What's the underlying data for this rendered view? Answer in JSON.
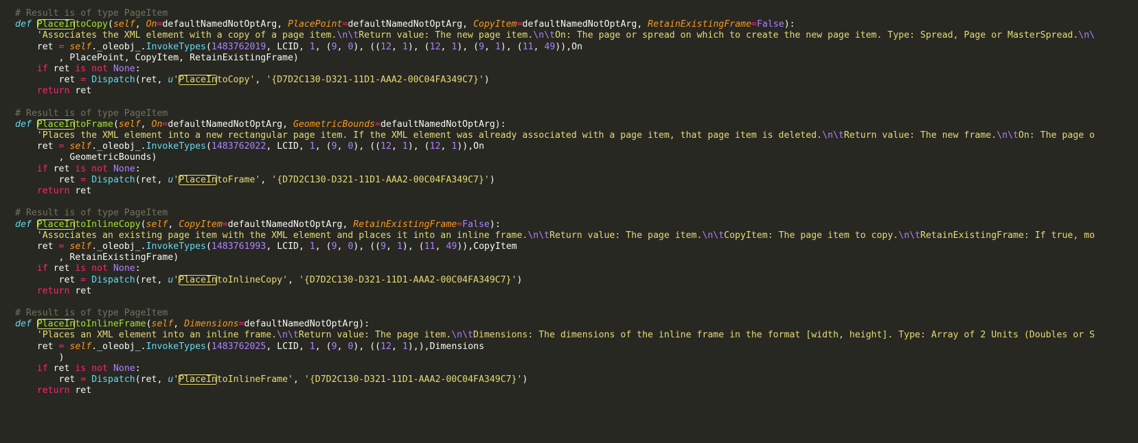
{
  "editor": {
    "lines": [
      [
        [
          "c-cmt",
          "# Result is of type PageItem"
        ]
      ],
      [
        [
          "c-def",
          "def"
        ],
        [
          "c-pl",
          " "
        ],
        [
          "c-hl hl-fn",
          "PlaceIn"
        ],
        [
          "c-fn",
          "toCopy"
        ],
        [
          "c-pl",
          "("
        ],
        [
          "c-self",
          "self"
        ],
        [
          "c-pl",
          ", "
        ],
        [
          "c-prm",
          "On"
        ],
        [
          "c-op",
          "="
        ],
        [
          "c-pl",
          "defaultNamedNotOptArg, "
        ],
        [
          "c-prm",
          "PlacePoint"
        ],
        [
          "c-op",
          "="
        ],
        [
          "c-pl",
          "defaultNamedNotOptArg, "
        ],
        [
          "c-prm",
          "CopyItem"
        ],
        [
          "c-op",
          "="
        ],
        [
          "c-pl",
          "defaultNamedNotOptArg, "
        ],
        [
          "c-prm",
          "RetainExistingFrame"
        ],
        [
          "c-op",
          "="
        ],
        [
          "c-const",
          "False"
        ],
        [
          "c-pl",
          "):"
        ]
      ],
      [
        [
          "c-pl",
          "    "
        ],
        [
          "c-str",
          "'Associates the XML element with a copy of a page item."
        ],
        [
          "c-esc",
          "\\n\\t"
        ],
        [
          "c-str",
          "Return value: The new page item."
        ],
        [
          "c-esc",
          "\\n\\t"
        ],
        [
          "c-str",
          "On: The page or spread on which to create the new page item. Type: Spread, Page or MasterSpread."
        ],
        [
          "c-esc",
          "\\n\\"
        ]
      ],
      [
        [
          "c-pl",
          "    ret "
        ],
        [
          "c-op",
          "="
        ],
        [
          "c-pl",
          " "
        ],
        [
          "c-self",
          "self"
        ],
        [
          "c-pl",
          "._oleobj_."
        ],
        [
          "c-call",
          "InvokeTypes"
        ],
        [
          "c-pl",
          "("
        ],
        [
          "c-num",
          "1483762019"
        ],
        [
          "c-pl",
          ", LCID, "
        ],
        [
          "c-num",
          "1"
        ],
        [
          "c-pl",
          ", ("
        ],
        [
          "c-num",
          "9"
        ],
        [
          "c-pl",
          ", "
        ],
        [
          "c-num",
          "0"
        ],
        [
          "c-pl",
          "), (("
        ],
        [
          "c-num",
          "12"
        ],
        [
          "c-pl",
          ", "
        ],
        [
          "c-num",
          "1"
        ],
        [
          "c-pl",
          "), ("
        ],
        [
          "c-num",
          "12"
        ],
        [
          "c-pl",
          ", "
        ],
        [
          "c-num",
          "1"
        ],
        [
          "c-pl",
          "), ("
        ],
        [
          "c-num",
          "9"
        ],
        [
          "c-pl",
          ", "
        ],
        [
          "c-num",
          "1"
        ],
        [
          "c-pl",
          "), ("
        ],
        [
          "c-num",
          "11"
        ],
        [
          "c-pl",
          ", "
        ],
        [
          "c-num",
          "49"
        ],
        [
          "c-pl",
          ")),On"
        ]
      ],
      [
        [
          "c-pl",
          "        , PlacePoint, CopyItem, RetainExistingFrame)"
        ]
      ],
      [
        [
          "c-pl",
          "    "
        ],
        [
          "c-kw",
          "if"
        ],
        [
          "c-pl",
          " ret "
        ],
        [
          "c-kw",
          "is not"
        ],
        [
          "c-pl",
          " "
        ],
        [
          "c-const",
          "None"
        ],
        [
          "c-pl",
          ":"
        ]
      ],
      [
        [
          "c-pl",
          "        ret "
        ],
        [
          "c-op",
          "="
        ],
        [
          "c-pl",
          " "
        ],
        [
          "c-call",
          "Dispatch"
        ],
        [
          "c-pl",
          "(ret, "
        ],
        [
          "c-def",
          "u"
        ],
        [
          "c-str",
          "'"
        ],
        [
          "c-hl hl-str",
          "PlaceIn"
        ],
        [
          "c-str",
          "toCopy'"
        ],
        [
          "c-pl",
          ", "
        ],
        [
          "c-str",
          "'{D7D2C130-D321-11D1-AAA2-00C04FA349C7}'"
        ],
        [
          "c-pl",
          ")"
        ]
      ],
      [
        [
          "c-pl",
          "    "
        ],
        [
          "c-kw",
          "return"
        ],
        [
          "c-pl",
          " ret"
        ]
      ],
      [],
      [
        [
          "c-cmt",
          "# Result is of type PageItem"
        ]
      ],
      [
        [
          "c-def",
          "def"
        ],
        [
          "c-pl",
          " "
        ],
        [
          "c-hl hl-fn",
          "PlaceIn"
        ],
        [
          "c-fn",
          "toFrame"
        ],
        [
          "c-pl",
          "("
        ],
        [
          "c-self",
          "self"
        ],
        [
          "c-pl",
          ", "
        ],
        [
          "c-prm",
          "On"
        ],
        [
          "c-op",
          "="
        ],
        [
          "c-pl",
          "defaultNamedNotOptArg, "
        ],
        [
          "c-prm",
          "GeometricBounds"
        ],
        [
          "c-op",
          "="
        ],
        [
          "c-pl",
          "defaultNamedNotOptArg):"
        ]
      ],
      [
        [
          "c-pl",
          "    "
        ],
        [
          "c-str",
          "'Places the XML element into a new rectangular page item. If the XML element was already associated with a page item, that page item is deleted."
        ],
        [
          "c-esc",
          "\\n\\t"
        ],
        [
          "c-str",
          "Return value: The new frame."
        ],
        [
          "c-esc",
          "\\n\\t"
        ],
        [
          "c-str",
          "On: The page o"
        ]
      ],
      [
        [
          "c-pl",
          "    ret "
        ],
        [
          "c-op",
          "="
        ],
        [
          "c-pl",
          " "
        ],
        [
          "c-self",
          "self"
        ],
        [
          "c-pl",
          "._oleobj_."
        ],
        [
          "c-call",
          "InvokeTypes"
        ],
        [
          "c-pl",
          "("
        ],
        [
          "c-num",
          "1483762022"
        ],
        [
          "c-pl",
          ", LCID, "
        ],
        [
          "c-num",
          "1"
        ],
        [
          "c-pl",
          ", ("
        ],
        [
          "c-num",
          "9"
        ],
        [
          "c-pl",
          ", "
        ],
        [
          "c-num",
          "0"
        ],
        [
          "c-pl",
          "), (("
        ],
        [
          "c-num",
          "12"
        ],
        [
          "c-pl",
          ", "
        ],
        [
          "c-num",
          "1"
        ],
        [
          "c-pl",
          "), ("
        ],
        [
          "c-num",
          "12"
        ],
        [
          "c-pl",
          ", "
        ],
        [
          "c-num",
          "1"
        ],
        [
          "c-pl",
          ")),On"
        ]
      ],
      [
        [
          "c-pl",
          "        , GeometricBounds)"
        ]
      ],
      [
        [
          "c-pl",
          "    "
        ],
        [
          "c-kw",
          "if"
        ],
        [
          "c-pl",
          " ret "
        ],
        [
          "c-kw",
          "is not"
        ],
        [
          "c-pl",
          " "
        ],
        [
          "c-const",
          "None"
        ],
        [
          "c-pl",
          ":"
        ]
      ],
      [
        [
          "c-pl",
          "        ret "
        ],
        [
          "c-op",
          "="
        ],
        [
          "c-pl",
          " "
        ],
        [
          "c-call",
          "Dispatch"
        ],
        [
          "c-pl",
          "(ret, "
        ],
        [
          "c-def",
          "u"
        ],
        [
          "c-str",
          "'"
        ],
        [
          "c-hl hl-str",
          "PlaceIn"
        ],
        [
          "c-str",
          "toFrame'"
        ],
        [
          "c-pl",
          ", "
        ],
        [
          "c-str",
          "'{D7D2C130-D321-11D1-AAA2-00C04FA349C7}'"
        ],
        [
          "c-pl",
          ")"
        ]
      ],
      [
        [
          "c-pl",
          "    "
        ],
        [
          "c-kw",
          "return"
        ],
        [
          "c-pl",
          " ret"
        ]
      ],
      [],
      [
        [
          "c-cmt",
          "# Result is of type PageItem"
        ]
      ],
      [
        [
          "c-def",
          "def"
        ],
        [
          "c-pl",
          " "
        ],
        [
          "c-hl hl-fn",
          "PlaceIn"
        ],
        [
          "c-fn",
          "toInlineCopy"
        ],
        [
          "c-pl",
          "("
        ],
        [
          "c-self",
          "self"
        ],
        [
          "c-pl",
          ", "
        ],
        [
          "c-prm",
          "CopyItem"
        ],
        [
          "c-op",
          "="
        ],
        [
          "c-pl",
          "defaultNamedNotOptArg, "
        ],
        [
          "c-prm",
          "RetainExistingFrame"
        ],
        [
          "c-op",
          "="
        ],
        [
          "c-const",
          "False"
        ],
        [
          "c-pl",
          "):"
        ]
      ],
      [
        [
          "c-pl",
          "    "
        ],
        [
          "c-str",
          "'Associates an existing page item with the XML element and places it into an inline frame."
        ],
        [
          "c-esc",
          "\\n\\t"
        ],
        [
          "c-str",
          "Return value: The page item."
        ],
        [
          "c-esc",
          "\\n\\t"
        ],
        [
          "c-str",
          "CopyItem: The page item to copy."
        ],
        [
          "c-esc",
          "\\n\\t"
        ],
        [
          "c-str",
          "RetainExistingFrame: If true, mo"
        ]
      ],
      [
        [
          "c-pl",
          "    ret "
        ],
        [
          "c-op",
          "="
        ],
        [
          "c-pl",
          " "
        ],
        [
          "c-self",
          "self"
        ],
        [
          "c-pl",
          "._oleobj_."
        ],
        [
          "c-call",
          "InvokeTypes"
        ],
        [
          "c-pl",
          "("
        ],
        [
          "c-num",
          "1483761993"
        ],
        [
          "c-pl",
          ", LCID, "
        ],
        [
          "c-num",
          "1"
        ],
        [
          "c-pl",
          ", ("
        ],
        [
          "c-num",
          "9"
        ],
        [
          "c-pl",
          ", "
        ],
        [
          "c-num",
          "0"
        ],
        [
          "c-pl",
          "), (("
        ],
        [
          "c-num",
          "9"
        ],
        [
          "c-pl",
          ", "
        ],
        [
          "c-num",
          "1"
        ],
        [
          "c-pl",
          "), ("
        ],
        [
          "c-num",
          "11"
        ],
        [
          "c-pl",
          ", "
        ],
        [
          "c-num",
          "49"
        ],
        [
          "c-pl",
          ")),CopyItem"
        ]
      ],
      [
        [
          "c-pl",
          "        , RetainExistingFrame)"
        ]
      ],
      [
        [
          "c-pl",
          "    "
        ],
        [
          "c-kw",
          "if"
        ],
        [
          "c-pl",
          " ret "
        ],
        [
          "c-kw",
          "is not"
        ],
        [
          "c-pl",
          " "
        ],
        [
          "c-const",
          "None"
        ],
        [
          "c-pl",
          ":"
        ]
      ],
      [
        [
          "c-pl",
          "        ret "
        ],
        [
          "c-op",
          "="
        ],
        [
          "c-pl",
          " "
        ],
        [
          "c-call",
          "Dispatch"
        ],
        [
          "c-pl",
          "(ret, "
        ],
        [
          "c-def",
          "u"
        ],
        [
          "c-str",
          "'"
        ],
        [
          "c-hl hl-str",
          "PlaceIn"
        ],
        [
          "c-str",
          "toInlineCopy'"
        ],
        [
          "c-pl",
          ", "
        ],
        [
          "c-str",
          "'{D7D2C130-D321-11D1-AAA2-00C04FA349C7}'"
        ],
        [
          "c-pl",
          ")"
        ]
      ],
      [
        [
          "c-pl",
          "    "
        ],
        [
          "c-kw",
          "return"
        ],
        [
          "c-pl",
          " ret"
        ]
      ],
      [],
      [
        [
          "c-cmt",
          "# Result is of type PageItem"
        ]
      ],
      [
        [
          "c-def",
          "def"
        ],
        [
          "c-pl",
          " "
        ],
        [
          "c-hl hl-fn",
          "PlaceIn"
        ],
        [
          "c-fn",
          "toInlineFrame"
        ],
        [
          "c-pl",
          "("
        ],
        [
          "c-self",
          "self"
        ],
        [
          "c-pl",
          ", "
        ],
        [
          "c-prm",
          "Dimensions"
        ],
        [
          "c-op",
          "="
        ],
        [
          "c-pl",
          "defaultNamedNotOptArg):"
        ]
      ],
      [
        [
          "c-pl",
          "    "
        ],
        [
          "c-str",
          "'Places an XML element into an inline frame."
        ],
        [
          "c-esc",
          "\\n\\t"
        ],
        [
          "c-str",
          "Return value: The page item."
        ],
        [
          "c-esc",
          "\\n\\t"
        ],
        [
          "c-str",
          "Dimensions: The dimensions of the inline frame in the format [width, height]. Type: Array of 2 Units (Doubles or S"
        ]
      ],
      [
        [
          "c-pl",
          "    ret "
        ],
        [
          "c-op",
          "="
        ],
        [
          "c-pl",
          " "
        ],
        [
          "c-self",
          "self"
        ],
        [
          "c-pl",
          "._oleobj_."
        ],
        [
          "c-call",
          "InvokeTypes"
        ],
        [
          "c-pl",
          "("
        ],
        [
          "c-num",
          "1483762025"
        ],
        [
          "c-pl",
          ", LCID, "
        ],
        [
          "c-num",
          "1"
        ],
        [
          "c-pl",
          ", ("
        ],
        [
          "c-num",
          "9"
        ],
        [
          "c-pl",
          ", "
        ],
        [
          "c-num",
          "0"
        ],
        [
          "c-pl",
          "), (("
        ],
        [
          "c-num",
          "12"
        ],
        [
          "c-pl",
          ", "
        ],
        [
          "c-num",
          "1"
        ],
        [
          "c-pl",
          "),),Dimensions"
        ]
      ],
      [
        [
          "c-pl",
          "        )"
        ]
      ],
      [
        [
          "c-pl",
          "    "
        ],
        [
          "c-kw",
          "if"
        ],
        [
          "c-pl",
          " ret "
        ],
        [
          "c-kw",
          "is not"
        ],
        [
          "c-pl",
          " "
        ],
        [
          "c-const",
          "None"
        ],
        [
          "c-pl",
          ":"
        ]
      ],
      [
        [
          "c-pl",
          "        ret "
        ],
        [
          "c-op",
          "="
        ],
        [
          "c-pl",
          " "
        ],
        [
          "c-call",
          "Dispatch"
        ],
        [
          "c-pl",
          "(ret, "
        ],
        [
          "c-def",
          "u"
        ],
        [
          "c-str",
          "'"
        ],
        [
          "c-hl hl-str",
          "PlaceIn"
        ],
        [
          "c-str",
          "toInlineFrame'"
        ],
        [
          "c-pl",
          ", "
        ],
        [
          "c-str",
          "'{D7D2C130-D321-11D1-AAA2-00C04FA349C7}'"
        ],
        [
          "c-pl",
          ")"
        ]
      ],
      [
        [
          "c-pl",
          "    "
        ],
        [
          "c-kw",
          "return"
        ],
        [
          "c-pl",
          " ret"
        ]
      ]
    ]
  }
}
